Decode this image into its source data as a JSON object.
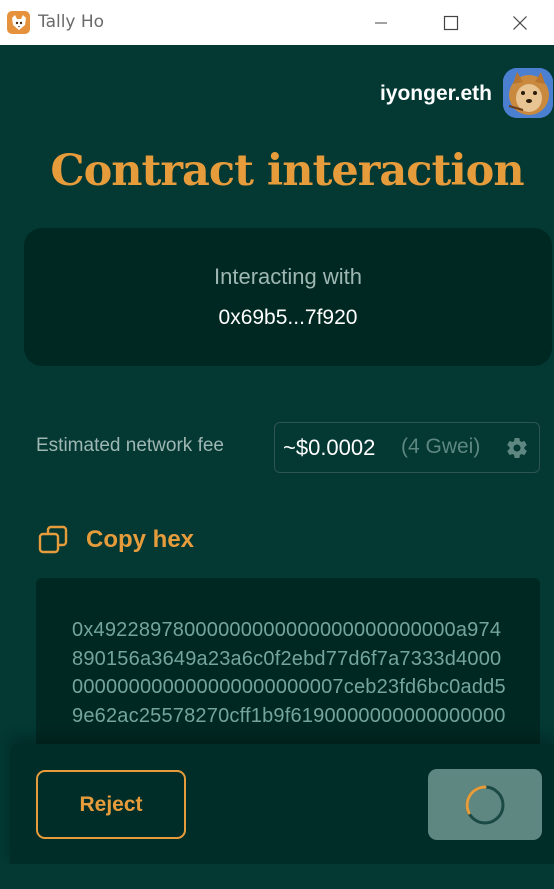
{
  "window": {
    "app_title": "Tally Ho",
    "app_icon": "tally-ho-fox-icon",
    "controls": {
      "minimize": "minimize-icon",
      "maximize": "maximize-icon",
      "close": "close-icon"
    }
  },
  "header": {
    "account_name": "iyonger.eth",
    "avatar": "fox-avatar"
  },
  "page": {
    "title": "Contract interaction"
  },
  "interaction": {
    "label": "Interacting with",
    "address": "0x69b5...7f920"
  },
  "network_fee": {
    "label": "Estimated network fee",
    "value": "~$0.0002",
    "gas": "(4 Gwei)",
    "settings_icon": "gear-icon"
  },
  "copy_hex": {
    "label": "Copy hex",
    "icon": "copy-icon"
  },
  "hex_data": {
    "text": "0x49228978000000000000000000000000a974890156a3649a23a6c0f2ebd77d6f7a7333d4000000000000000000000000007ceb23fd6bc0add59e62ac25578270cff1b9f6190000000000000000"
  },
  "footer": {
    "reject_label": "Reject",
    "confirm_state": "loading"
  },
  "colors": {
    "background": "#033833",
    "panel": "#002822",
    "accent": "#e79c3c",
    "muted_text": "#9fb7b2",
    "hex_text": "#74a59c",
    "disabled_button": "#5f8781"
  }
}
